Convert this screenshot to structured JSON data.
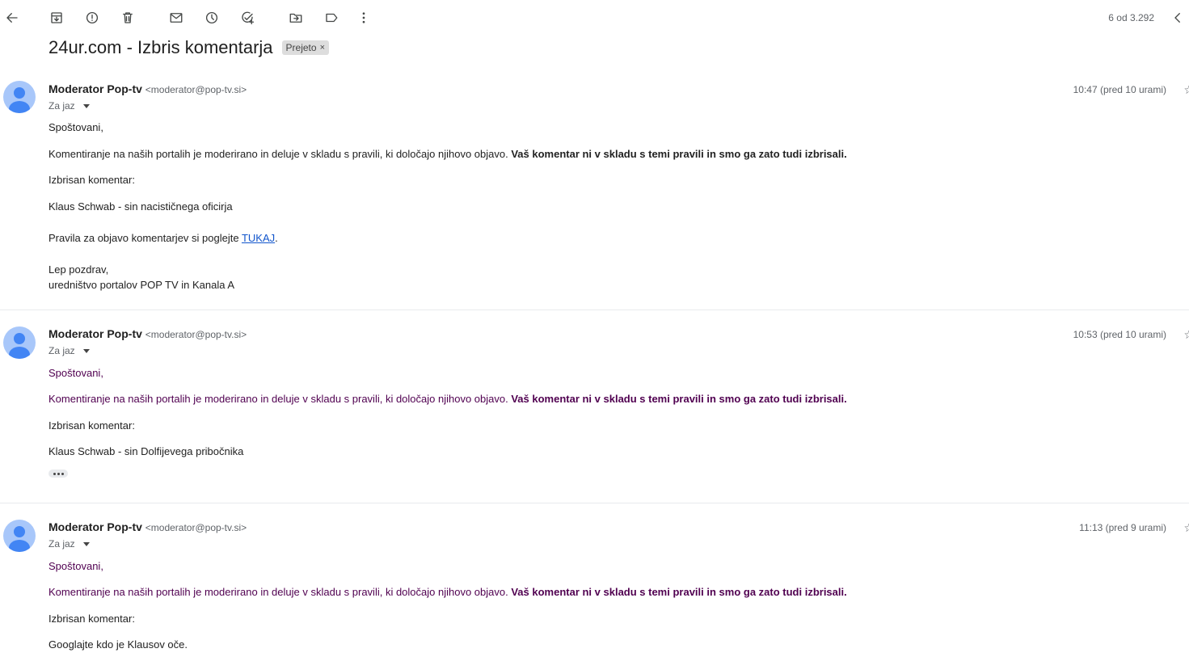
{
  "toolbar": {
    "icons": [
      "back-arrow-icon",
      "archive-icon",
      "report-spam-icon",
      "delete-icon",
      "mark-unread-icon",
      "snooze-icon",
      "add-task-icon",
      "move-to-icon",
      "label-icon",
      "more-vert-icon"
    ],
    "pager": "6 od 3.292"
  },
  "subject": {
    "title": "24ur.com - Izbris komentarja",
    "label": "Prejeto",
    "label_remove": "×"
  },
  "messages": [
    {
      "sender": "Moderator Pop-tv",
      "email": "<moderator@pop-tv.si>",
      "to": "Za jaz",
      "time": "10:47 (pred 10 urami)",
      "greeting": "Spoštovani,",
      "para_normal": "Komentiranje na naših portalih je moderirano in deluje v skladu s pravili, ki določajo njihovo objavo. ",
      "para_bold": "Vaš komentar ni v skladu s temi pravili in smo ga zato tudi izbrisali.",
      "deleted_label": "Izbrisan komentar:",
      "deleted_comment": "Klaus Schwab - sin nacističnega oficirja",
      "rules_text": "Pravila za objavo komentarjev si poglejte ",
      "rules_link": "TUKAJ",
      "rules_end": ".",
      "closing1": "Lep pozdrav,",
      "closing2": "uredništvo portalov POP TV in Kanala A"
    },
    {
      "sender": "Moderator Pop-tv",
      "email": "<moderator@pop-tv.si>",
      "to": "Za jaz",
      "time": "10:53 (pred 10 urami)",
      "greeting": "Spoštovani,",
      "para_normal": "Komentiranje na naših portalih je moderirano in deluje v skladu s pravili, ki določajo njihovo objavo. ",
      "para_bold": "Vaš komentar ni v skladu s temi pravili in smo ga zato tudi izbrisali.",
      "deleted_label": "Izbrisan komentar:",
      "deleted_comment": "Klaus Schwab - sin Dolfijevega pribočnika"
    },
    {
      "sender": "Moderator Pop-tv",
      "email": "<moderator@pop-tv.si>",
      "to": "Za jaz",
      "time": "11:13 (pred 9 urami)",
      "greeting": "Spoštovani,",
      "para_normal": "Komentiranje na naših portalih je moderirano in deluje v skladu s pravili, ki določajo njihovo objavo. ",
      "para_bold": "Vaš komentar ni v skladu s temi pravili in smo ga zato tudi izbrisali.",
      "deleted_label": "Izbrisan komentar:",
      "deleted_comment": "Googlajte kdo je Klausov oče."
    }
  ],
  "colors": {
    "quoted_text": "#500050",
    "avatar_bg": "#a8c7fa",
    "avatar_fg": "#4285f4",
    "link": "#1155cc"
  }
}
